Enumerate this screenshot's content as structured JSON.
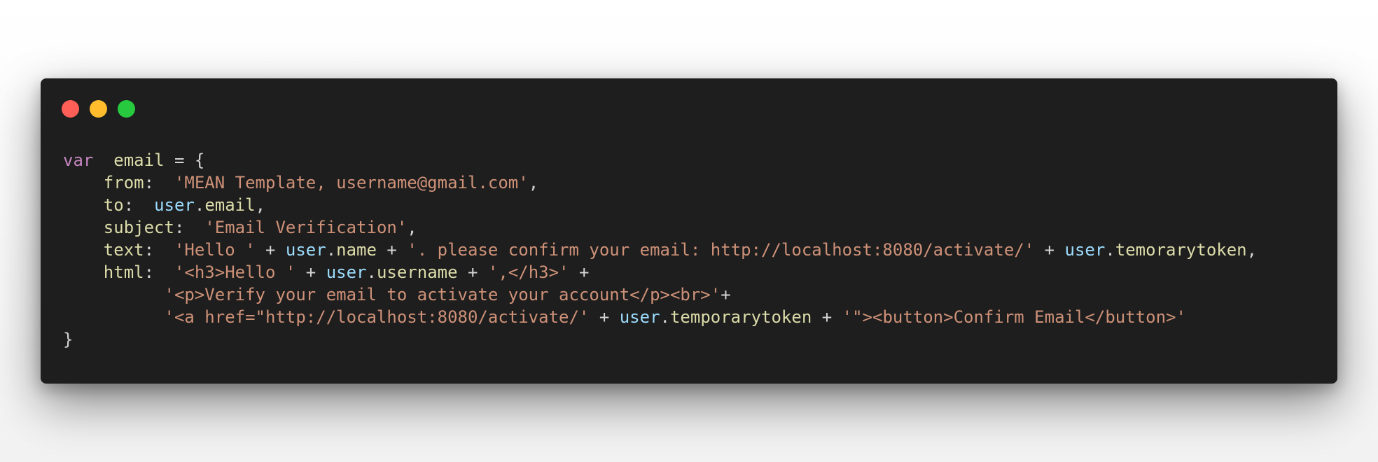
{
  "window": {
    "controls": [
      {
        "name": "close",
        "color": "#ff5f56"
      },
      {
        "name": "minimize",
        "color": "#ffbd2e"
      },
      {
        "name": "maximize",
        "color": "#27c93f"
      }
    ]
  },
  "colors": {
    "background": "#1e1e1e",
    "keyword": "#c586c0",
    "string": "#ce9178",
    "object": "#9cdcfe",
    "property": "#dcdcaa",
    "plain": "#d4d4d4"
  },
  "code": {
    "lines": [
      [
        {
          "t": "var",
          "k": "keyword"
        },
        {
          "t": "  ",
          "k": "plain"
        },
        {
          "t": "email",
          "k": "var"
        },
        {
          "t": " = {",
          "k": "plain"
        }
      ],
      [
        {
          "t": "    ",
          "k": "plain"
        },
        {
          "t": "from",
          "k": "prop"
        },
        {
          "t": ":  ",
          "k": "plain"
        },
        {
          "t": "'MEAN Template, username@gmail.com'",
          "k": "string"
        },
        {
          "t": ",",
          "k": "plain"
        }
      ],
      [
        {
          "t": "    ",
          "k": "plain"
        },
        {
          "t": "to",
          "k": "prop"
        },
        {
          "t": ":  ",
          "k": "plain"
        },
        {
          "t": "user",
          "k": "object"
        },
        {
          "t": ".",
          "k": "plain"
        },
        {
          "t": "email",
          "k": "member"
        },
        {
          "t": ",",
          "k": "plain"
        }
      ],
      [
        {
          "t": "    ",
          "k": "plain"
        },
        {
          "t": "subject",
          "k": "prop"
        },
        {
          "t": ":  ",
          "k": "plain"
        },
        {
          "t": "'Email Verification'",
          "k": "string"
        },
        {
          "t": ",",
          "k": "plain"
        }
      ],
      [
        {
          "t": "    ",
          "k": "plain"
        },
        {
          "t": "text",
          "k": "prop"
        },
        {
          "t": ":  ",
          "k": "plain"
        },
        {
          "t": "'Hello '",
          "k": "string"
        },
        {
          "t": " + ",
          "k": "plain"
        },
        {
          "t": "user",
          "k": "object"
        },
        {
          "t": ".",
          "k": "plain"
        },
        {
          "t": "name",
          "k": "member"
        },
        {
          "t": " + ",
          "k": "plain"
        },
        {
          "t": "'. please confirm your email: http://localhost:8080/activate/'",
          "k": "string"
        },
        {
          "t": " + ",
          "k": "plain"
        },
        {
          "t": "user",
          "k": "object"
        },
        {
          "t": ".",
          "k": "plain"
        },
        {
          "t": "temorarytoken",
          "k": "member"
        },
        {
          "t": ",",
          "k": "plain"
        }
      ],
      [
        {
          "t": "    ",
          "k": "plain"
        },
        {
          "t": "html",
          "k": "prop"
        },
        {
          "t": ":  ",
          "k": "plain"
        },
        {
          "t": "'<h3>Hello '",
          "k": "string"
        },
        {
          "t": " + ",
          "k": "plain"
        },
        {
          "t": "user",
          "k": "object"
        },
        {
          "t": ".",
          "k": "plain"
        },
        {
          "t": "username",
          "k": "member"
        },
        {
          "t": " + ",
          "k": "plain"
        },
        {
          "t": "',</h3>'",
          "k": "string"
        },
        {
          "t": " +",
          "k": "plain"
        }
      ],
      [
        {
          "t": "          ",
          "k": "plain"
        },
        {
          "t": "'<p>Verify your email to activate your account</p><br>'",
          "k": "string"
        },
        {
          "t": "+",
          "k": "plain"
        }
      ],
      [
        {
          "t": "          ",
          "k": "plain"
        },
        {
          "t": "'<a href=\"http://localhost:8080/activate/'",
          "k": "string"
        },
        {
          "t": " + ",
          "k": "plain"
        },
        {
          "t": "user",
          "k": "object"
        },
        {
          "t": ".",
          "k": "plain"
        },
        {
          "t": "temporarytoken",
          "k": "member"
        },
        {
          "t": " + ",
          "k": "plain"
        },
        {
          "t": "'\"><button>Confirm Email</button>'",
          "k": "string"
        }
      ],
      [
        {
          "t": "}",
          "k": "plain"
        }
      ]
    ]
  }
}
